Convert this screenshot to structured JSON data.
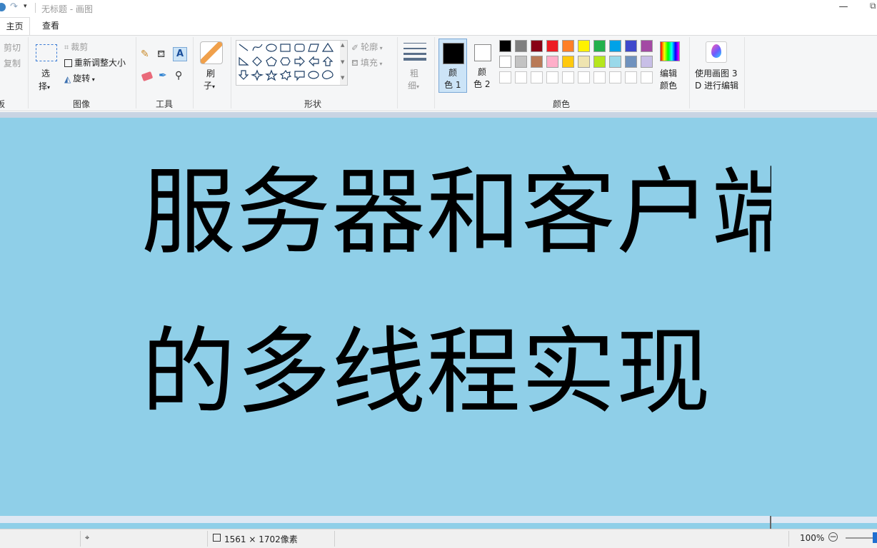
{
  "window": {
    "title": "无标题 - 画图"
  },
  "tabs": [
    {
      "label": "主页"
    },
    {
      "label": "查看"
    }
  ],
  "clipboard": {
    "cut": "剪切",
    "copy": "复制",
    "group": "板"
  },
  "image": {
    "crop": "裁剪",
    "resize": "重新调整大小",
    "rotate": "旋转",
    "select_1": "选",
    "select_2": "择",
    "group": "图像"
  },
  "tools": {
    "group": "工具"
  },
  "brushes": {
    "label_1": "刷",
    "label_2": "子"
  },
  "shapes": {
    "outline": "轮廓",
    "fill": "填充",
    "group": "形状"
  },
  "size": {
    "label_1": "粗",
    "label_2": "细"
  },
  "colors": {
    "color1_line1": "颜",
    "color1_line2": "色 1",
    "color2_line1": "颜",
    "color2_line2": "色 2",
    "edit_line1": "编辑",
    "edit_line2": "颜色",
    "group": "颜色",
    "row1": [
      "#000000",
      "#7f7f7f",
      "#880015",
      "#ed1c24",
      "#ff7f27",
      "#fff200",
      "#22b14c",
      "#00a2e8",
      "#3f48cc",
      "#a349a4"
    ],
    "row2": [
      "#ffffff",
      "#c3c3c3",
      "#b97a57",
      "#ffaec9",
      "#ffc90e",
      "#efe4b0",
      "#b5e61d",
      "#99d9ea",
      "#7092be",
      "#c8bfe7"
    ],
    "selected_color1": "#000000",
    "selected_color2": "#ffffff"
  },
  "paint3d": {
    "line1": "使用画图 3",
    "line2": "D 进行编辑"
  },
  "canvas": {
    "background": "#8fcfe8",
    "line1": "服务器和客户端",
    "line2": "的多线程实现"
  },
  "status": {
    "dimensions": "1561 × 1702像素",
    "zoom": "100%"
  }
}
